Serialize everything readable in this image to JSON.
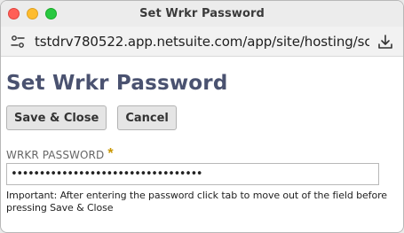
{
  "window": {
    "title": "Set Wrkr Password"
  },
  "browser": {
    "url": "tstdrv780522.app.netsuite.com/app/site/hosting/scr...",
    "site_icon": "site-settings-icon",
    "download_icon": "download-icon"
  },
  "page": {
    "title": "Set Wrkr Password"
  },
  "toolbar": {
    "save_close_label": "Save & Close",
    "cancel_label": "Cancel"
  },
  "form": {
    "password_label": "WRKR PASSWORD",
    "required_marker": "*",
    "password_value": "••••••••••••••••••••••••••••••••••",
    "help_text": "Important: After entering the password click tab to move out of the field before pressing Save & Close"
  },
  "colors": {
    "title": "#4a5270",
    "required": "#c99700",
    "traffic_red": "#ff5f57",
    "traffic_yellow": "#febc2e",
    "traffic_green": "#28c840"
  }
}
